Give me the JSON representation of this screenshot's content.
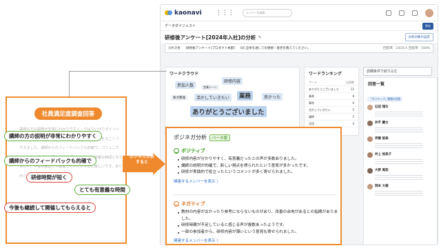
{
  "app": {
    "logo_text": "kaonavi",
    "grid_label": "⋮⋮⋮",
    "search_placeholder": "メンバーを検索",
    "breadcrumb": "データダイジェスト",
    "breadcrumb_button": "保存",
    "page_title": "研修後アンケート[2024年入社]の分析",
    "title_button": "分析対象の設定",
    "filter": {
      "label": "分析対象",
      "sheet": "研修後アンケート[プロダクト本部]",
      "question": "Q5.全体を通しての感想・意見を教えてください。",
      "stats": "回答率：23/25人 回答率：100%"
    },
    "wordcloud_title": "ワードクラウド",
    "words": [
      "参加人数",
      "営業シーン",
      "研修内容",
      "要点整理",
      "活かしていきたい",
      "業務",
      "良かった",
      "ありがとうございました"
    ],
    "ranking_title": "ワードランキング",
    "ranking_header": [
      "ワード",
      "出現数"
    ],
    "ranking_rows": [
      [
        "ありがとうございました",
        "12"
      ],
      [
        "業務",
        "8"
      ],
      [
        "事例",
        "6"
      ],
      [
        "活かしていきたい",
        "5"
      ],
      [
        "講師",
        "5"
      ],
      [
        "活用",
        "4"
      ]
    ],
    "side_button": "詳細条件で絞り込む",
    "side_title": "回答一覧",
    "side_tag": "「ポジティブ」関連の回答",
    "people": [
      "石田 瑞生",
      "井手 慶太",
      "伊藤 智美",
      "井上 裕美子",
      "大野 真梨",
      "岡本 大樹"
    ]
  },
  "survey": {
    "title": "社員満足度調査回答",
    "body": "講師の方の説明が非常にわかりやすく、やはりいかりポイントも含まれていたため、日々の業務にもプラスの部分をえこくつできました。講師からのフィードバックも的確で、コミュニケーションの観点では研修時間が短く、とても有意義な時間となりました。今後も継続して開催していただけると嬉しいです。ありがとうございました。",
    "highlights": [
      "講師の方の説明が非常にわかりやすく",
      "講師からのフィードバックも的確で",
      "研修時間が短く",
      "とても有意義な時間",
      "今後も継続して開催してもらえると"
    ]
  },
  "arrow_label": "ポジネガ分析\nすると",
  "posinega": {
    "title": "ポジネガ分析",
    "badge": "ベータ版",
    "positive": {
      "heading": "ポジティブ",
      "bullets": [
        "研修内容が分かりやすく、有意義だったとの声が多数ありました。",
        "講師の説明が的確で、新しい視点を得られたという意見が多かったです。",
        "研修が実践的で役立ったというコメントが多く寄せられました。"
      ],
      "link": "関連するメンバーを表示 〉"
    },
    "negative": {
      "heading": "ネガティブ",
      "bullets": [
        "教材の内容が古かったり参考にならないものがあり、改善の余地があるとの指摘がありました。",
        "研修時間が不足していると感じる声が複数あったようです。",
        "一部の参加者から、研修内容が薄いという意見も寄せられました。"
      ],
      "link": "関連するメンバーを表示 〉"
    }
  },
  "colors": {
    "accent": "#ee8a2d",
    "positive": "#3d9a21",
    "negative": "#e07421",
    "link": "#2c6cc4",
    "pill_green": "#5cae3c",
    "pill_red": "#e0413c"
  }
}
